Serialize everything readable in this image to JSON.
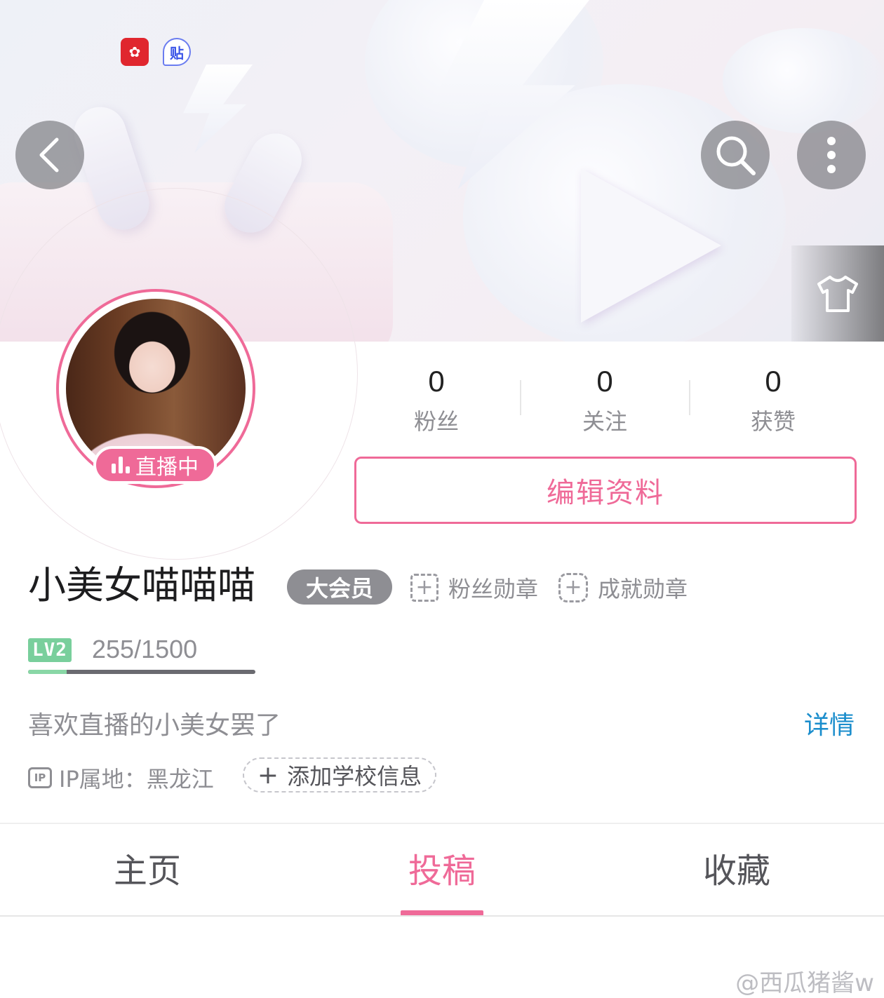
{
  "status_bar": {
    "app_icon_1": "app-red-icon",
    "app_icon_2_label": "贴"
  },
  "header": {
    "back_icon": "chevron-left-icon",
    "search_icon": "search-icon",
    "more_icon": "more-vertical-icon",
    "skin_icon": "tshirt-icon"
  },
  "profile": {
    "live_label": "直播中",
    "stats": [
      {
        "value": "0",
        "label": "粉丝"
      },
      {
        "value": "0",
        "label": "关注"
      },
      {
        "value": "0",
        "label": "获赞"
      }
    ],
    "edit_button": "编辑资料",
    "username": "小美女喵喵喵",
    "vip_badge": "大会员",
    "fan_medal": "粉丝勋章",
    "achievement_medal": "成就勋章",
    "level_badge": "LV2",
    "level_progress_text": "255/1500",
    "level_progress_fraction": 0.17,
    "bio": "喜欢直播的小美女罢了",
    "detail_link": "详情",
    "ip_icon_text": "IP",
    "ip_location": "IP属地：黑龙江",
    "add_school": "添加学校信息"
  },
  "tabs": [
    {
      "label": "主页",
      "active": false
    },
    {
      "label": "投稿",
      "active": true
    },
    {
      "label": "收藏",
      "active": false
    }
  ],
  "watermark": "@西瓜猪酱w",
  "colors": {
    "accent_pink": "#ef6a98",
    "link_blue": "#1a8dcc",
    "level_green": "#79cf9c",
    "muted_gray": "#8e8e93"
  }
}
